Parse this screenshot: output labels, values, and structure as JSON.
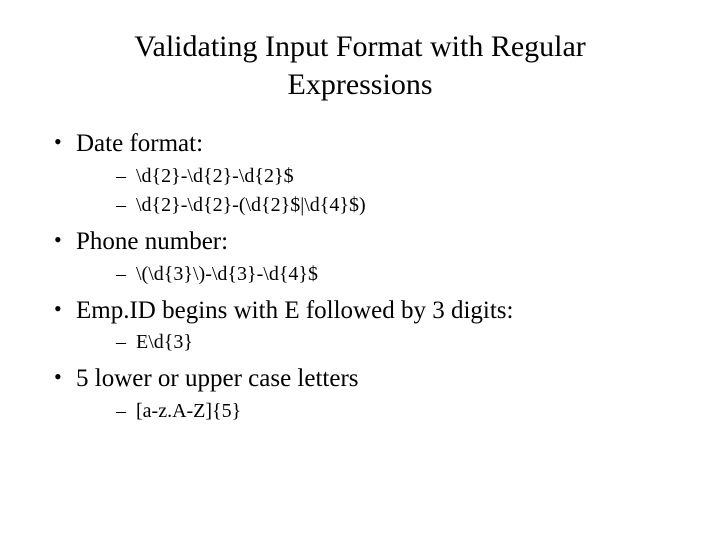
{
  "title_line1": "Validating Input Format with Regular",
  "title_line2": "Expressions",
  "items": [
    {
      "label": "Date format:",
      "subs": [
        "\\d{2}-\\d{2}-\\d{2}$",
        "\\d{2}-\\d{2}-(\\d{2}$|\\d{4}$)"
      ]
    },
    {
      "label": "Phone number:",
      "subs": [
        "\\(\\d{3}\\)-\\d{3}-\\d{4}$"
      ]
    },
    {
      "label": "Emp.ID begins with E followed by 3 digits:",
      "subs": [
        "E\\d{3}"
      ]
    },
    {
      "label": "5 lower or upper case letters",
      "subs": [
        "[a-z.A-Z]{5}"
      ]
    }
  ]
}
